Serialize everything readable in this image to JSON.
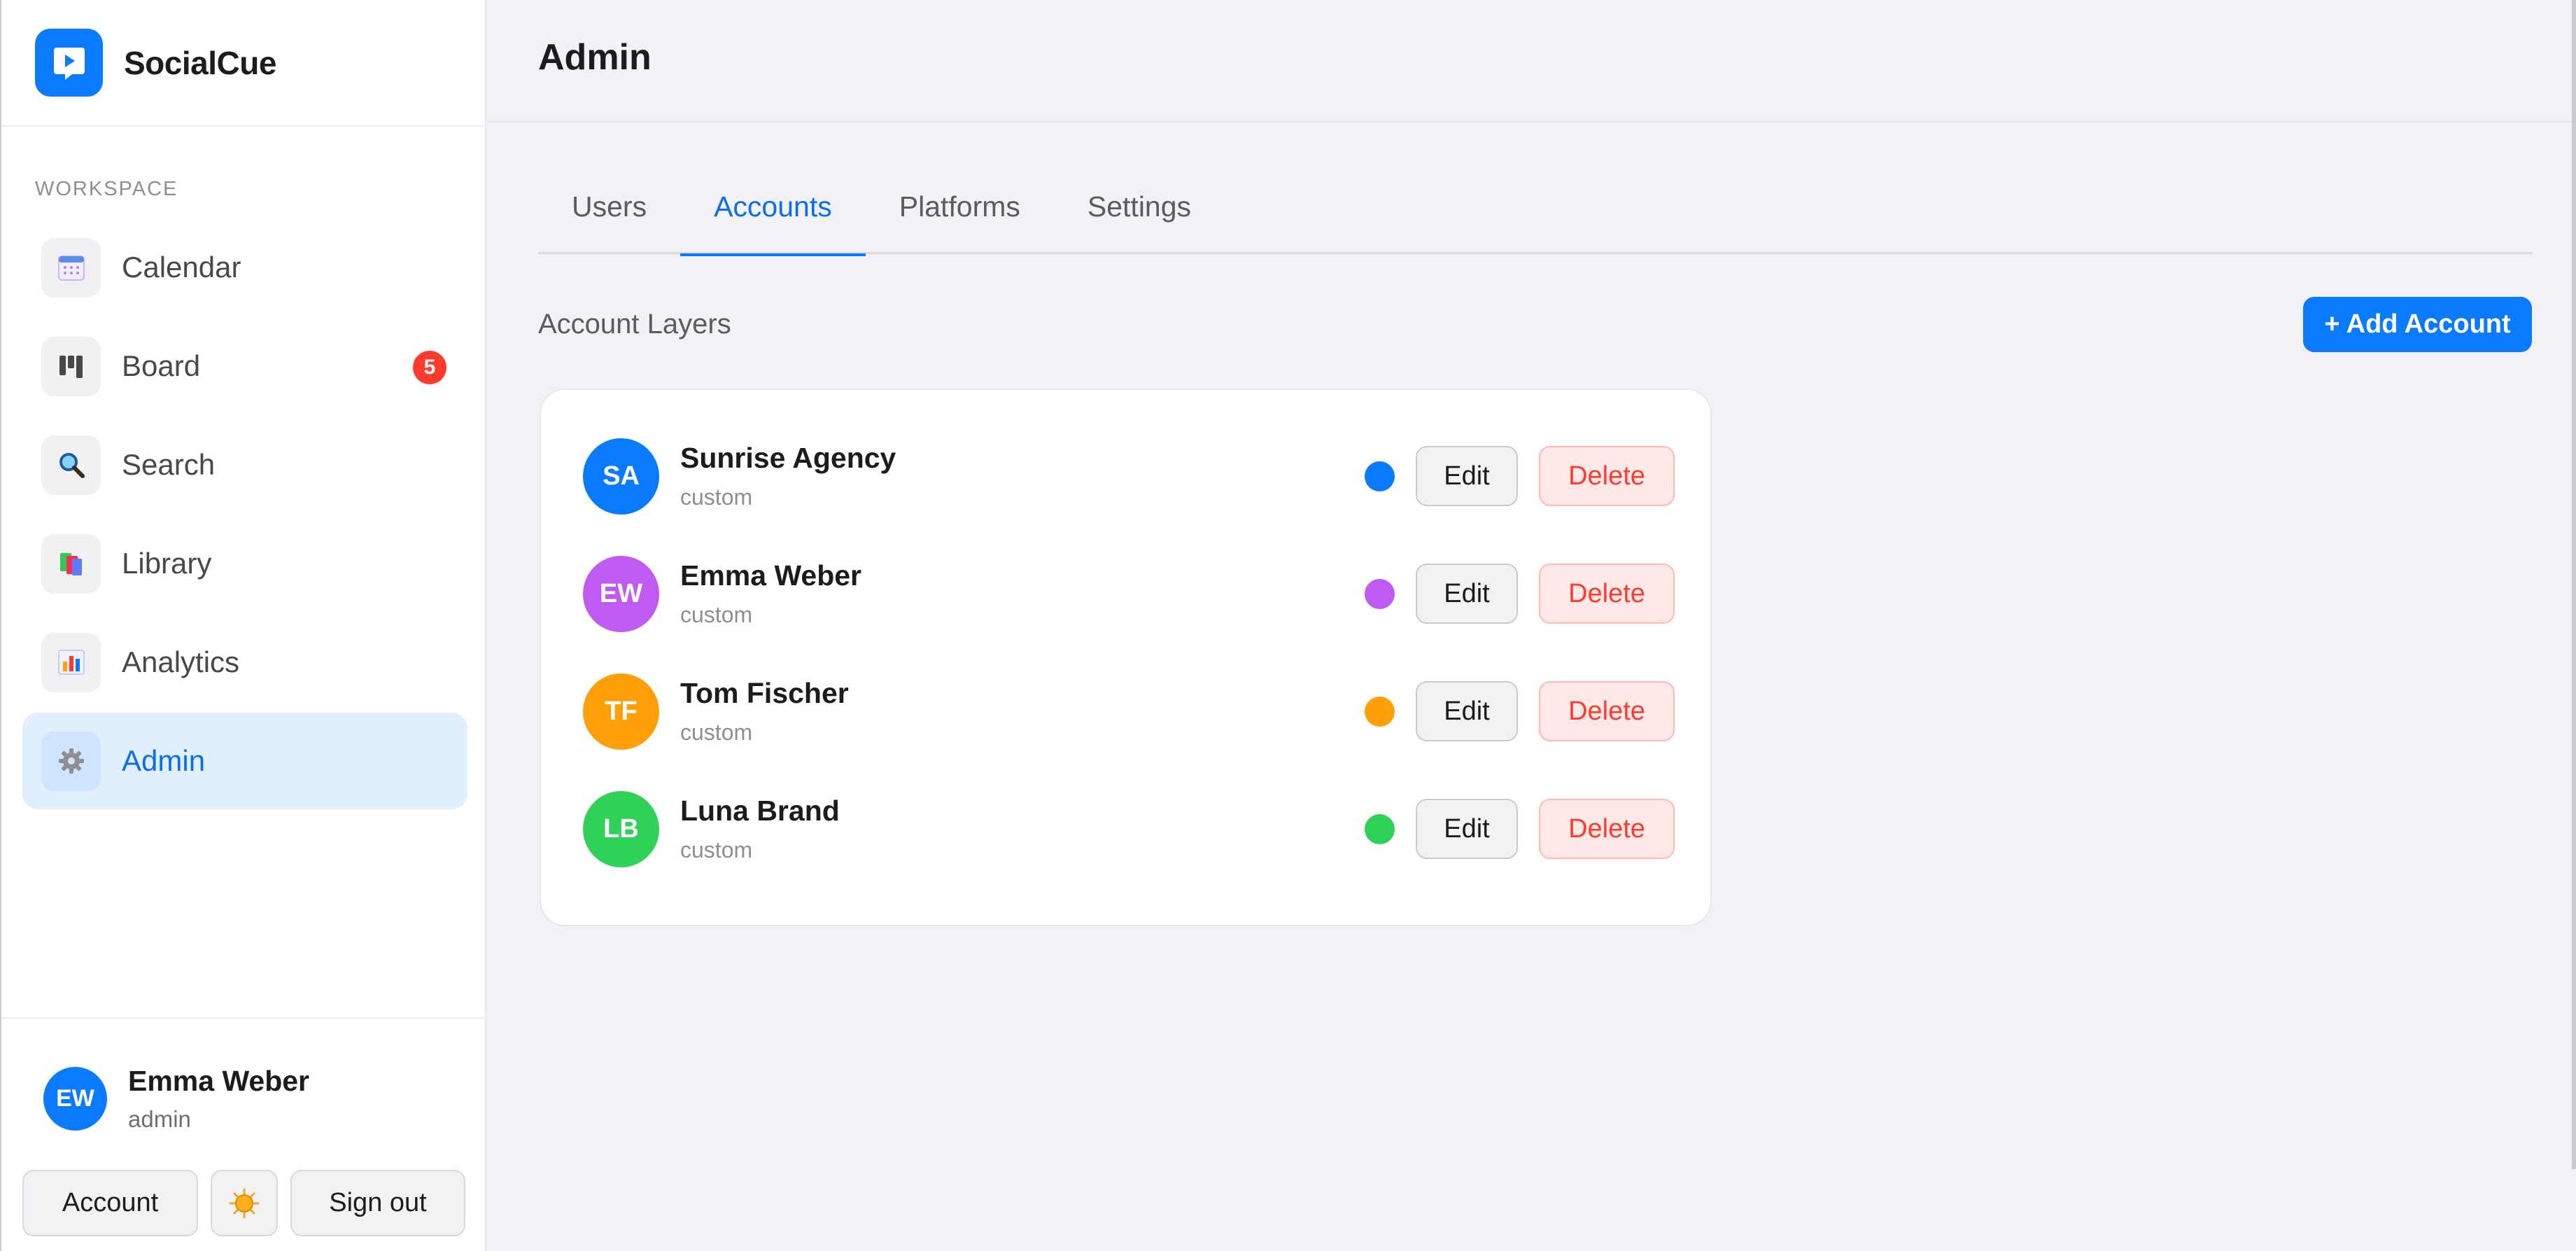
{
  "app": {
    "name": "SocialCue"
  },
  "sidebar": {
    "section_label": "WORKSPACE",
    "items": [
      {
        "label": "Calendar",
        "icon": "calendar-icon"
      },
      {
        "label": "Board",
        "icon": "board-icon",
        "badge": "5"
      },
      {
        "label": "Search",
        "icon": "search-icon"
      },
      {
        "label": "Library",
        "icon": "library-icon"
      },
      {
        "label": "Analytics",
        "icon": "analytics-icon"
      },
      {
        "label": "Admin",
        "icon": "gear-icon",
        "active": true
      }
    ],
    "user": {
      "initials": "EW",
      "name": "Emma Weber",
      "role": "admin"
    },
    "footer": {
      "account_label": "Account",
      "theme_icon": "sun-icon",
      "signout_label": "Sign out"
    }
  },
  "header": {
    "title": "Admin"
  },
  "tabs": [
    {
      "label": "Users"
    },
    {
      "label": "Accounts",
      "active": true
    },
    {
      "label": "Platforms"
    },
    {
      "label": "Settings"
    }
  ],
  "accounts": {
    "section_title": "Account Layers",
    "add_label": "+ Add Account",
    "edit_label": "Edit",
    "delete_label": "Delete",
    "rows": [
      {
        "initials": "SA",
        "name": "Sunrise Agency",
        "type": "custom",
        "color": "#0a7aff"
      },
      {
        "initials": "EW",
        "name": "Emma Weber",
        "type": "custom",
        "color": "#bf5af2"
      },
      {
        "initials": "TF",
        "name": "Tom Fischer",
        "type": "custom",
        "color": "#ff9f0a"
      },
      {
        "initials": "LB",
        "name": "Luna Brand",
        "type": "custom",
        "color": "#30d158"
      }
    ]
  },
  "colors": {
    "accent": "#0a7aff",
    "badge": "#ff3b30",
    "danger": "#ff3b30"
  }
}
